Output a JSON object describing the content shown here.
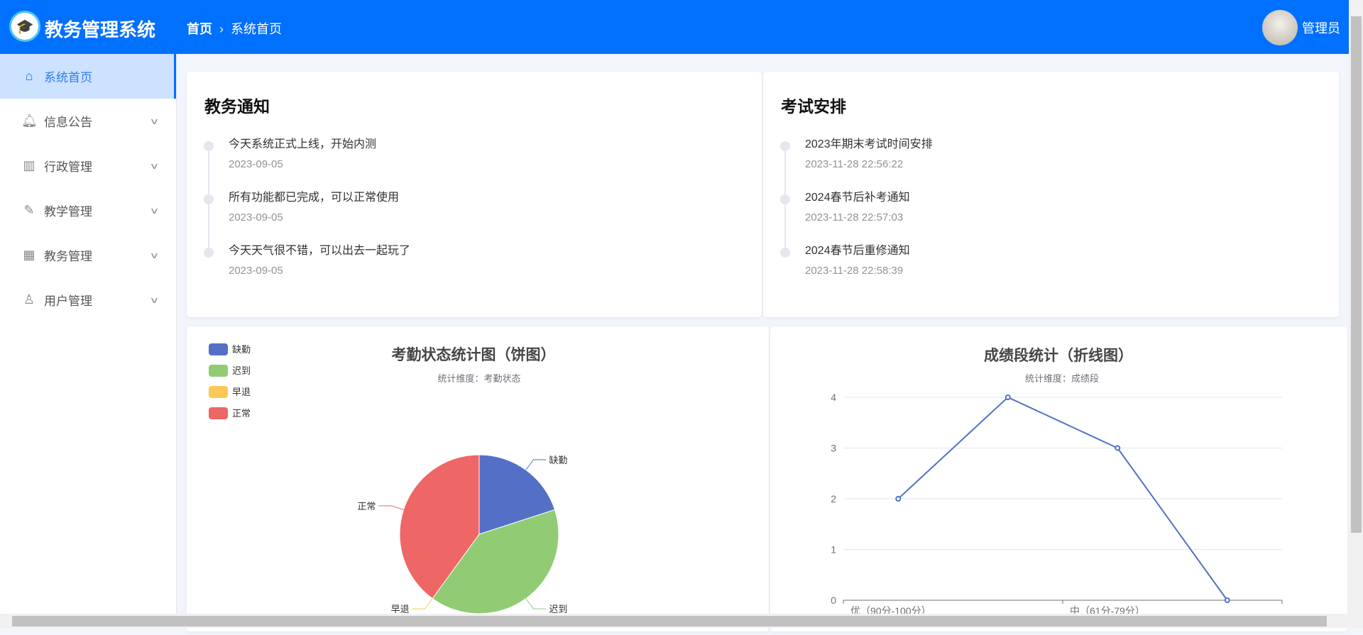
{
  "header": {
    "app_title": "教务管理系统",
    "breadcrumb": [
      "首页",
      "系统首页"
    ],
    "user_name": "管理员",
    "accent": "#0070ff"
  },
  "sidebar": {
    "items": [
      {
        "label": "系统首页",
        "icon": "home-icon",
        "active": true
      },
      {
        "label": "信息公告",
        "icon": "bell-icon"
      },
      {
        "label": "行政管理",
        "icon": "building-icon"
      },
      {
        "label": "教学管理",
        "icon": "edit-icon"
      },
      {
        "label": "教务管理",
        "icon": "calendar-icon"
      },
      {
        "label": "用户管理",
        "icon": "user-icon"
      }
    ]
  },
  "notices": {
    "title": "教务通知",
    "items": [
      {
        "text": "今天系统正式上线，开始内测",
        "date": "2023-09-05"
      },
      {
        "text": "所有功能都已完成，可以正常使用",
        "date": "2023-09-05"
      },
      {
        "text": "今天天气很不错，可以出去一起玩了",
        "date": "2023-09-05"
      }
    ]
  },
  "exams": {
    "title": "考试安排",
    "items": [
      {
        "text": "2023年期末考试时间安排",
        "date": "2023-11-28 22:56:22"
      },
      {
        "text": "2024春节后补考通知",
        "date": "2023-11-28 22:57:03"
      },
      {
        "text": "2024春节后重修通知",
        "date": "2023-11-28 22:58:39"
      }
    ]
  },
  "chart_data": [
    {
      "type": "pie",
      "title": "考勤状态统计图（饼图）",
      "subtitle": "统计维度：考勤状态",
      "legend_position": "top-left",
      "categories": [
        "缺勤",
        "迟到",
        "早退",
        "正常"
      ],
      "values": [
        1,
        2,
        0,
        2
      ],
      "colors": [
        "#5470c6",
        "#91cc75",
        "#fac858",
        "#ee6666"
      ]
    },
    {
      "type": "line",
      "title": "成绩段统计（折线图）",
      "subtitle": "统计维度：成绩段",
      "categories": [
        "优（90分-100分）",
        "",
        "中（61分-79分）",
        ""
      ],
      "values": [
        2,
        4,
        3,
        0
      ],
      "ylim": [
        0,
        4
      ],
      "yticks": [
        0,
        1,
        2,
        3,
        4
      ],
      "grid": true,
      "color": "#5470c6"
    }
  ]
}
